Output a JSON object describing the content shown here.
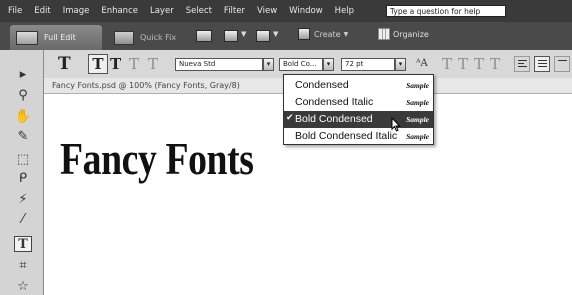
{
  "menubar": {
    "items": [
      "File",
      "Edit",
      "Image",
      "Enhance",
      "Layer",
      "Select",
      "Filter",
      "View",
      "Window",
      "Help"
    ],
    "help_field": "Type a question for help"
  },
  "shortcuts": {
    "full_edit": "Full Edit",
    "quick_fix": "Quick Fix",
    "create": "Create",
    "organize": "Organize",
    "icons": [
      "print-icon",
      "tray-icon",
      "share-icon",
      "create-icon",
      "organize-grid-icon"
    ]
  },
  "options": {
    "font_family": "Nueva Std",
    "font_style": "Bold Co...",
    "font_size": "72 pt"
  },
  "document": {
    "title": "Fancy Fonts.psd @ 100% (Fancy Fonts, Gray/8)",
    "text": "Fancy Fonts"
  },
  "style_dropdown": {
    "items": [
      {
        "label": "Condensed",
        "sample": "Sample"
      },
      {
        "label": "Condensed Italic",
        "sample": "Sample"
      },
      {
        "label": "Bold Condensed",
        "sample": "Sample",
        "checkmark": "✔"
      },
      {
        "label": "Bold Condensed Italic",
        "sample": "Sample"
      }
    ],
    "selected_index": 2
  },
  "colors": {
    "menubar_bg": "#3a3a3a",
    "options_bg": "#d8d8d8",
    "selected_item_bg": "#3a3a3a"
  }
}
